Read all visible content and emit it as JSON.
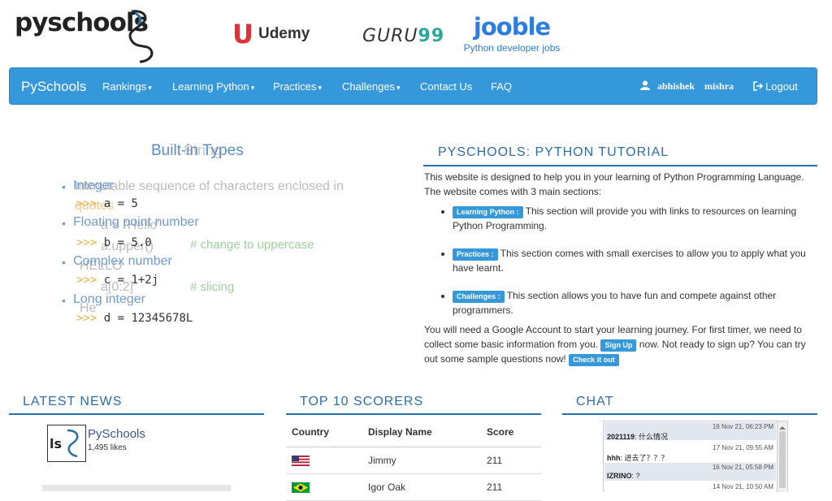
{
  "header": {
    "logo_text": "pyschools",
    "ads": {
      "udemy": "Udemy",
      "guru_text": "GURU",
      "guru_num": "99",
      "jooble": "jooble",
      "jooble_sub": "Python developer jobs"
    }
  },
  "nav": {
    "brand": "PySchools",
    "items": [
      "Rankings",
      "Learning Python",
      "Practices",
      "Challenges",
      "Contact Us",
      "FAQ"
    ],
    "user_first": "abhishek",
    "user_last": "mishra",
    "logout": "Logout"
  },
  "builtin": {
    "heading": "Built-in Types",
    "ghost_heading": "String",
    "items": [
      "Integer",
      "Floating point number",
      "Complex number",
      "Long integer"
    ],
    "prompt": ">>>",
    "codes": [
      "a = 5",
      "b = 5.0",
      "c = 1+2j",
      "d = 12345678L"
    ],
    "ghost": {
      "line1": "Immutable sequence of characters enclosed in",
      "line2": "quotes",
      "line3": "a = \"Hello\"",
      "line4": "a.upper()",
      "line5": "HELLO",
      "line6": "a[0:2]",
      "line7": "He"
    },
    "comments": [
      "# change to uppercase",
      "# slicing"
    ]
  },
  "tutorial": {
    "title": "PYSCHOOLS: PYTHON TUTORIAL",
    "intro": "This website is designed to help you in your learning of Python Programming Language. The website comes with 3 main sections:",
    "sections": [
      {
        "badge": "Learning Python :",
        "text": "This section will provide you with links to resources on learning Python Programming."
      },
      {
        "badge": "Practices :",
        "text": "This section comes with small exercises to allow you to apply what you have learnt."
      },
      {
        "badge": "Challenges :",
        "text": "This section allows you to have fun and compete against other programmers."
      }
    ],
    "outro1": "You will need a Google Account to start your learning journey. For first timer, we need to collect some basic information from you.",
    "signup": "Sign Up",
    "outro2": "now. Not ready to sign up? You can try out some sample questions now!",
    "checkout": "Check it out"
  },
  "news": {
    "title": "LATEST NEWS",
    "page_name": "PySchools",
    "likes": "1,495 likes"
  },
  "scorers": {
    "title": "TOP 10 SCORERS",
    "headers": [
      "Country",
      "Display Name",
      "Score"
    ],
    "rows": [
      {
        "country": "USA",
        "name": "Jimmy",
        "score": "211"
      },
      {
        "country": "Brazil",
        "name": "Igor Oak",
        "score": "211"
      }
    ]
  },
  "chat": {
    "title": "CHAT",
    "messages": [
      {
        "time": "19 Nov 21, 06:23 PM",
        "user": "2021119",
        "text": ": 什么情况"
      },
      {
        "time": "17 Nov 21, 09:55 AM",
        "user": "hhh",
        "text": ": 进去了？？？"
      },
      {
        "time": "16 Nov 21, 05:58 PM",
        "user": "IZRINO",
        "text": ": ?"
      },
      {
        "time": "14 Nov 21, 10:50 AM",
        "user": "",
        "text": ""
      }
    ]
  },
  "colors": {
    "accent": "#3498db",
    "heading": "#2b6ea8"
  }
}
